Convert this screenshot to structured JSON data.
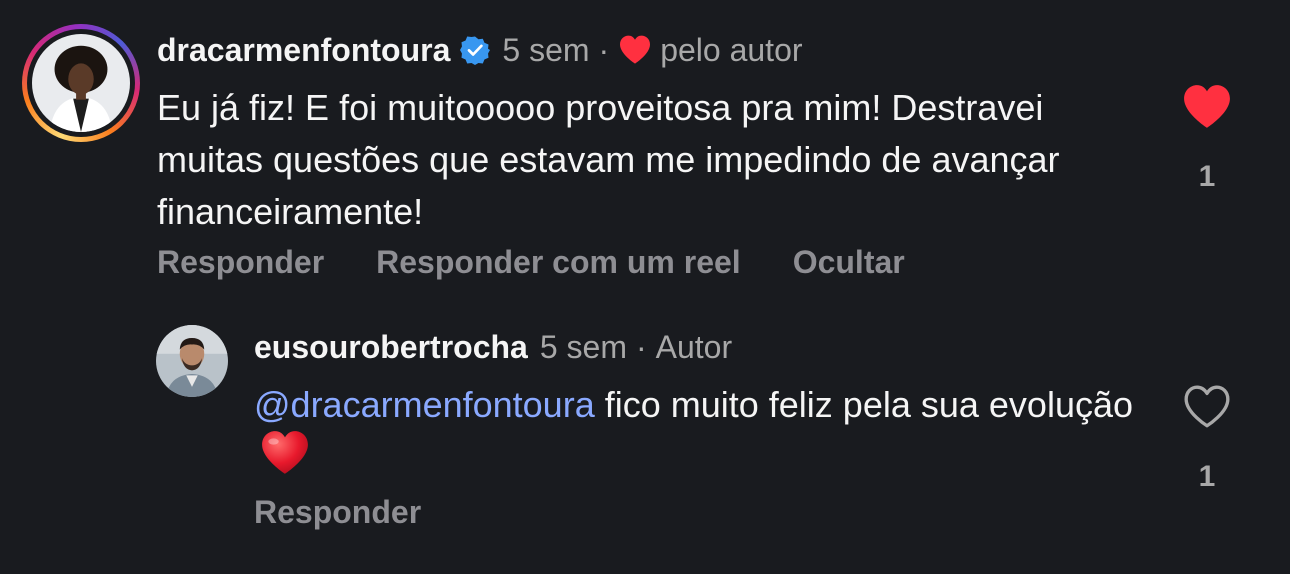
{
  "comment": {
    "username": "dracarmenfontoura",
    "time": "5 sem",
    "separator": "·",
    "author_like_label": "pelo autor",
    "text": "Eu já fiz! E foi muitooooo proveitosa pra mim! Destravei muitas questões que estavam me impedindo de avançar financeiramente!",
    "actions": {
      "reply": "Responder",
      "reply_reel": "Responder com um reel",
      "hide": "Ocultar"
    },
    "likes": "1",
    "liked": true
  },
  "reply": {
    "username": "eusourobertrocha",
    "time": "5 sem",
    "separator": "·",
    "author_label": "Autor",
    "mention": "@dracarmenfontoura",
    "text": " fico muito feliz pela sua evolução",
    "actions": {
      "reply": "Responder"
    },
    "likes": "1",
    "liked": false
  },
  "colors": {
    "background": "#191b1f",
    "like_red": "#ff3040",
    "mention_blue": "#8aa9ff",
    "verified_blue": "#3897f0",
    "muted_text": "#8e8e93"
  },
  "icons": {
    "verified": "verified-badge-icon",
    "author_heart": "heart-filled-icon",
    "like_filled": "heart-filled-icon",
    "like_outline": "heart-outline-icon",
    "emoji": "red-heart-emoji"
  }
}
